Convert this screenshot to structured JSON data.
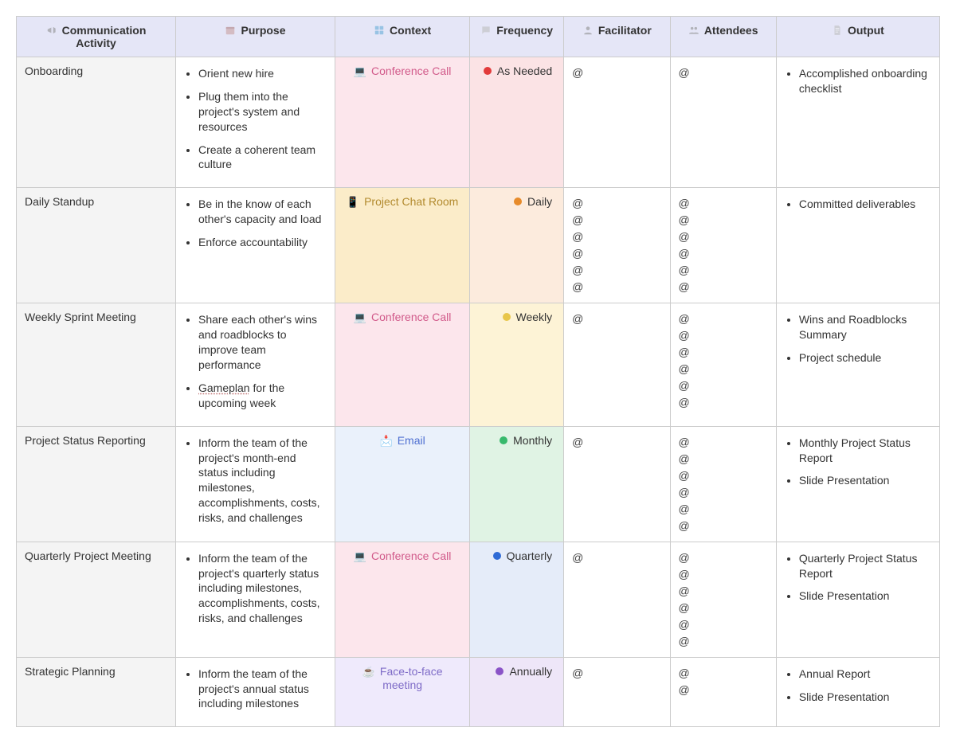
{
  "headers": {
    "activity": "Communication Activity",
    "purpose": "Purpose",
    "context": "Context",
    "frequency": "Frequency",
    "facilitator": "Facilitator",
    "attendees": "Attendees",
    "output": "Output"
  },
  "header_icons": {
    "activity": "megaphone-icon",
    "purpose": "calendar-icon",
    "context": "grid-icon",
    "frequency": "chat-icon",
    "facilitator": "person-icon",
    "attendees": "people-icon",
    "output": "document-icon"
  },
  "context_options": {
    "conference_call": {
      "label": "Conference Call",
      "icon": "💻",
      "css": "pink"
    },
    "project_chat": {
      "label": "Project Chat Room",
      "icon": "📱",
      "css": "amber"
    },
    "email": {
      "label": "Email",
      "icon": "📩",
      "css": "blue"
    },
    "face_to_face": {
      "label": "Face-to-face meeting",
      "icon": "☕",
      "css": "lilac"
    }
  },
  "frequency_options": {
    "as_needed": {
      "label": "As Needed",
      "dot": "red",
      "css": "pink"
    },
    "daily": {
      "label": "Daily",
      "dot": "orange",
      "css": "orange"
    },
    "weekly": {
      "label": "Weekly",
      "dot": "yellow",
      "css": "yellow"
    },
    "monthly": {
      "label": "Monthly",
      "dot": "green",
      "css": "green"
    },
    "quarterly": {
      "label": "Quarterly",
      "dot": "blue",
      "css": "blue"
    },
    "annually": {
      "label": "Annually",
      "dot": "purple",
      "css": "purple"
    }
  },
  "rows": [
    {
      "activity": "Onboarding",
      "purpose": [
        "Orient new hire",
        "Plug them into the project's system and resources",
        "Create a coherent team culture"
      ],
      "context": "conference_call",
      "frequency": "as_needed",
      "facilitator_count": 1,
      "attendee_count": 1,
      "output": [
        "Accomplished onboarding checklist"
      ]
    },
    {
      "activity": "Daily Standup",
      "purpose": [
        "Be in the know of each other's capacity and load",
        "Enforce accountability"
      ],
      "context": "project_chat",
      "frequency": "daily",
      "facilitator_count": 6,
      "attendee_count": 6,
      "output": [
        "Committed deliverables"
      ]
    },
    {
      "activity": "Weekly Sprint Meeting",
      "purpose": [
        "Share each other's wins and roadblocks to improve team performance",
        {
          "spelled": true,
          "text": "Gameplan",
          "tail": " for the upcoming week"
        }
      ],
      "context": "conference_call",
      "frequency": "weekly",
      "facilitator_count": 1,
      "attendee_count": 6,
      "output": [
        "Wins and Roadblocks Summary",
        "Project schedule"
      ]
    },
    {
      "activity": "Project Status Reporting",
      "purpose": [
        "Inform the team of the project's month-end status including milestones, accomplishments, costs, risks, and challenges"
      ],
      "context": "email",
      "frequency": "monthly",
      "facilitator_count": 1,
      "attendee_count": 6,
      "output": [
        "Monthly Project Status Report",
        "Slide Presentation"
      ]
    },
    {
      "activity": "Quarterly Project Meeting",
      "purpose": [
        "Inform the team of the project's quarterly status including milestones, accomplishments, costs, risks, and challenges"
      ],
      "context": "conference_call",
      "frequency": "quarterly",
      "facilitator_count": 1,
      "attendee_count": 6,
      "output": [
        "Quarterly Project Status Report",
        "Slide Presentation"
      ]
    },
    {
      "activity": "Strategic Planning",
      "purpose": [
        "Inform the team of the project's annual status including milestones"
      ],
      "truncated": true,
      "context": "face_to_face",
      "frequency": "annually",
      "facilitator_count": 1,
      "attendee_count": 2,
      "output": [
        "Annual Report",
        "Slide Presentation"
      ]
    }
  ]
}
